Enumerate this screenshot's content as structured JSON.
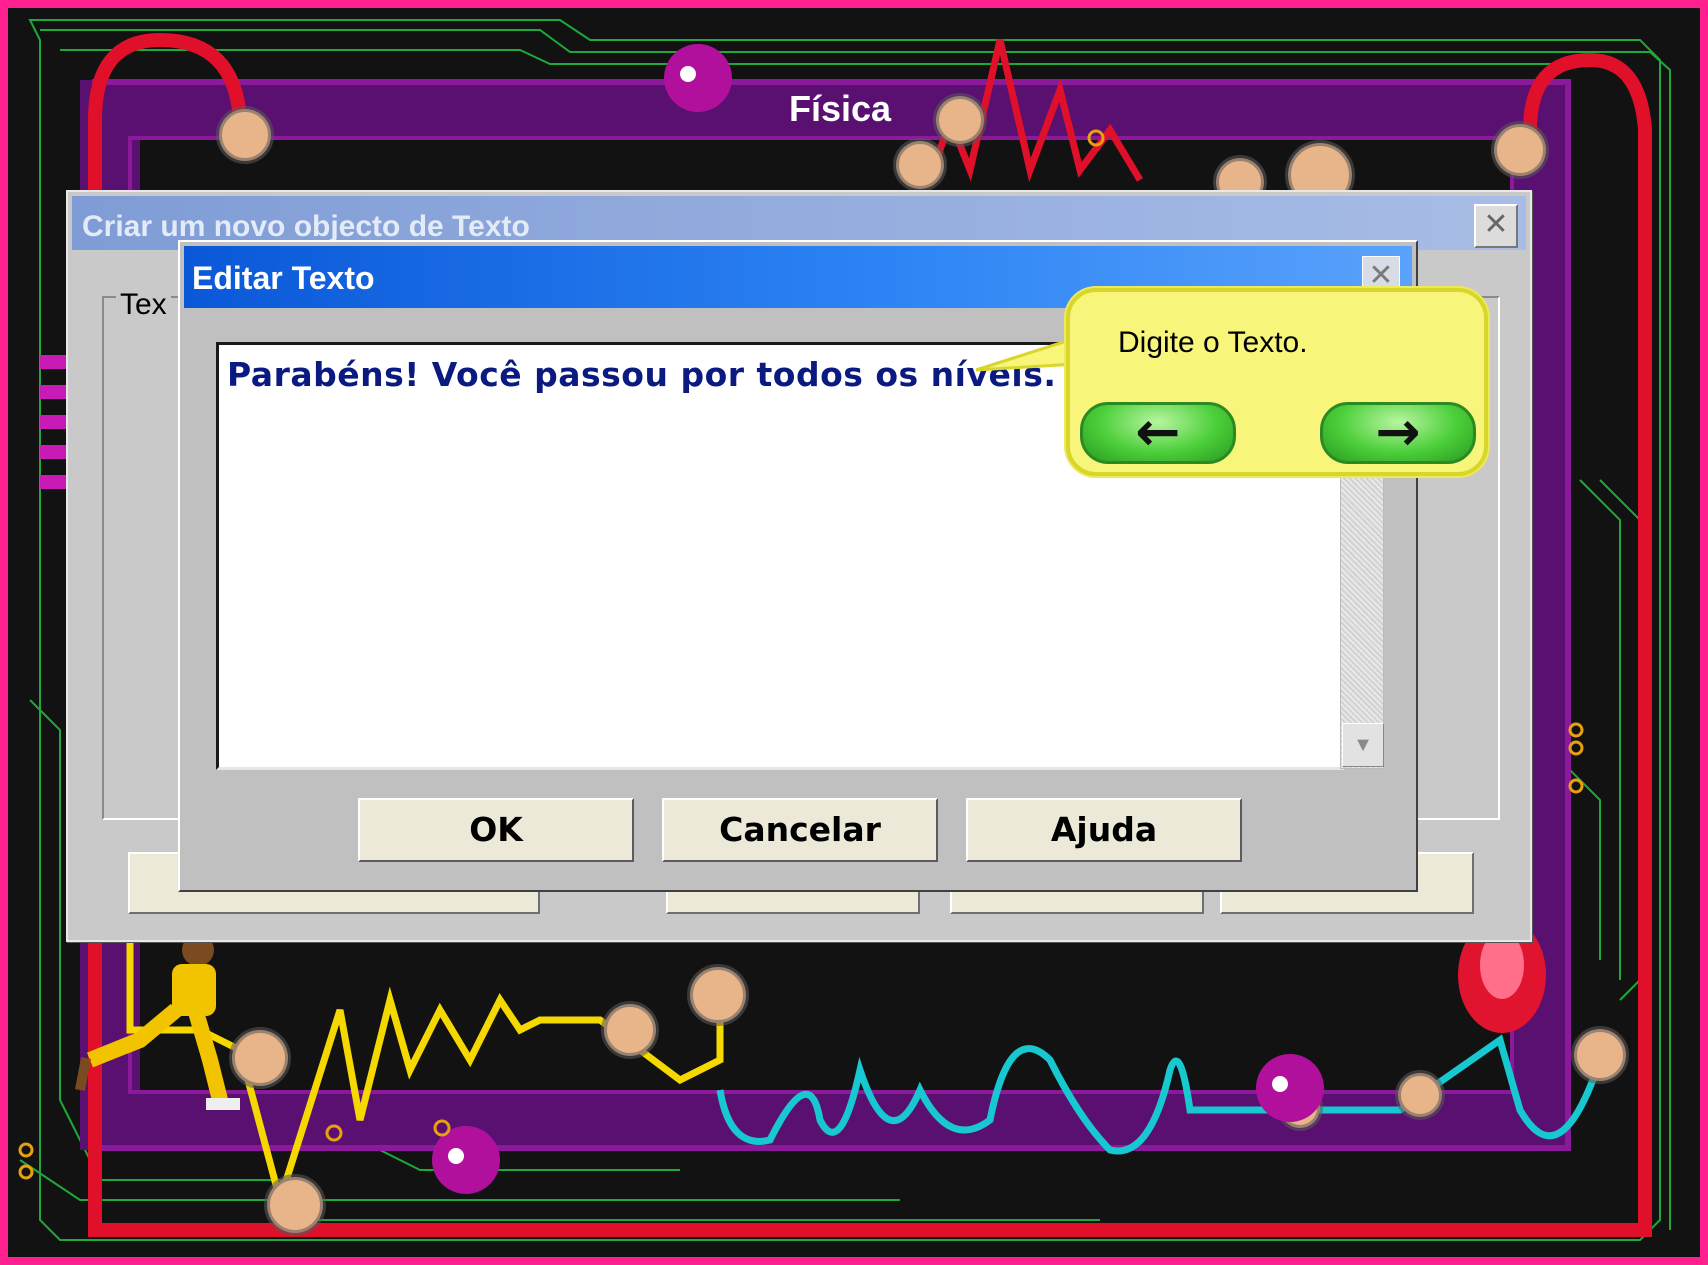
{
  "board": {
    "title": "Física"
  },
  "back_dialog": {
    "title": "Criar um novo objecto de Texto",
    "group_label": "Tex"
  },
  "edit_dialog": {
    "title": "Editar Texto",
    "text": "Parabéns! Você passou por todos os níveis.",
    "buttons": {
      "ok": "OK",
      "cancel": "Cancelar",
      "help": "Ajuda"
    }
  },
  "tooltip": {
    "text": "Digite o Texto."
  },
  "icons": {
    "close": "close-icon",
    "prev": "arrow-left-icon",
    "next": "arrow-right-icon",
    "scroll_down": "chevron-down-icon"
  },
  "colors": {
    "frame_pink": "#ff1f8f",
    "purple": "#660055",
    "titlebar_blue": "#0a58d8",
    "balloon_yellow": "#f7f57a",
    "arrow_green": "#4ccf3a"
  }
}
